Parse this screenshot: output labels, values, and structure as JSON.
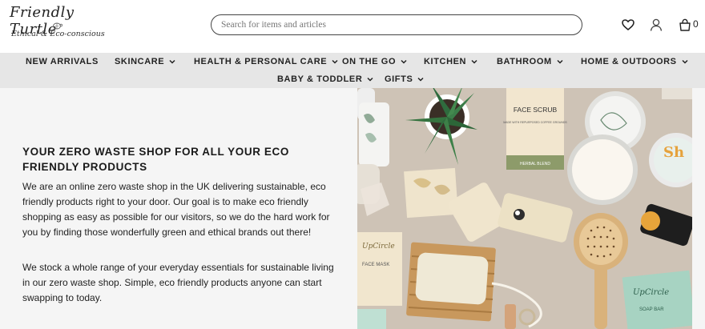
{
  "brand": {
    "logo_title": "Friendly Turtle",
    "logo_tagline": "Ethical & Eco-conscious"
  },
  "search": {
    "placeholder": "Search for items and articles"
  },
  "header_icons": [
    "heart-icon",
    "user-icon",
    "cart-icon"
  ],
  "cart": {
    "count": "0"
  },
  "nav": {
    "row1": [
      {
        "label": "NEW ARRIVALS",
        "dropdown": false
      },
      {
        "label": "SKINCARE",
        "dropdown": true
      },
      {
        "label": "HEALTH & PERSONAL CARE",
        "dropdown": true
      },
      {
        "label": "ON THE GO",
        "dropdown": true
      },
      {
        "label": "KITCHEN",
        "dropdown": true
      },
      {
        "label": "BATHROOM",
        "dropdown": true
      },
      {
        "label": "HOME & OUTDOORS",
        "dropdown": true
      }
    ],
    "row2": [
      {
        "label": "BABY & TODDLER",
        "dropdown": true
      },
      {
        "label": "GIFTS",
        "dropdown": true
      }
    ]
  },
  "hero": {
    "heading": "YOUR ZERO WASTE SHOP FOR ALL YOUR ECO FRIENDLY PRODUCTS",
    "paragraph1": "We are an online zero waste shop in the UK delivering sustainable, eco friendly products right to your door. Our goal is to make eco friendly shopping as easy as possible for our visitors, so we do the hard work for you by finding those wonderfully green and ethical brands out there!",
    "paragraph2": "We stock a whole range of your everyday essentials for sustainable living in our zero waste shop. Simple, eco friendly products anyone can start swapping to today.",
    "image_labels": {
      "face_scrub": "FACE SCRUB",
      "face_scrub_sub": "MADE WITH REPURPOSED COFFEE GROUNDS",
      "herbal_blend": "HERBAL BLEND",
      "upcircle": "UpCircle",
      "face_mask": "FACE MASK",
      "soap_bar": "SOAP BAR",
      "soap_letter": "Sh"
    }
  },
  "colors": {
    "nav_bg": "#e6e6e6",
    "content_bg": "#f5f5f5",
    "photo_bg": "#d2c6bb"
  }
}
